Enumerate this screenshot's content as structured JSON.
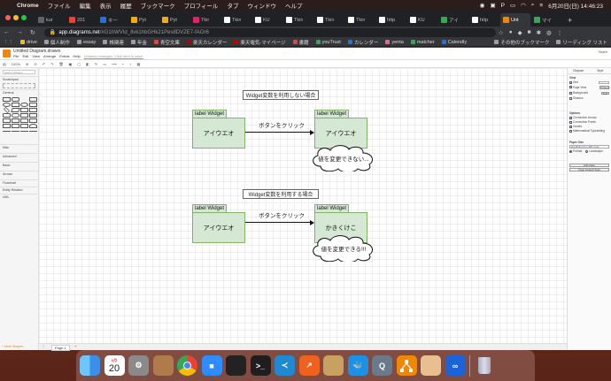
{
  "menubar": {
    "app": "Chrome",
    "items": [
      "ファイル",
      "編集",
      "表示",
      "履歴",
      "ブックマーク",
      "プロフィール",
      "タブ",
      "ウィンドウ",
      "ヘルプ"
    ],
    "datetime": "6月20日(日) 14:46:23"
  },
  "tabs": [
    {
      "label": "kur",
      "color": "#5f6368"
    },
    {
      "label": "201",
      "color": "#ea4335"
    },
    {
      "label": "キー",
      "color": "#1a73e8"
    },
    {
      "label": "Pyt",
      "color": "#f9ab00"
    },
    {
      "label": "Pyt",
      "color": "#f9ab00"
    },
    {
      "label": "Tkir",
      "color": "#e91e63"
    },
    {
      "label": "Tkin",
      "color": "#ffffff"
    },
    {
      "label": "KU",
      "color": "#ffffff"
    },
    {
      "label": "Tkin",
      "color": "#ffffff"
    },
    {
      "label": "Tkin",
      "color": "#ffffff"
    },
    {
      "label": "Tkin",
      "color": "#ffffff"
    },
    {
      "label": "http",
      "color": "#ffffff"
    },
    {
      "label": "KU",
      "color": "#ffffff"
    },
    {
      "label": "アイ",
      "color": "#34a853"
    },
    {
      "label": "http",
      "color": "#ffffff"
    },
    {
      "label": "Unt",
      "color": "#f08705",
      "active": true
    },
    {
      "label": "マイ",
      "color": "#34a853"
    }
  ],
  "address": {
    "domain": "app.diagrams.net",
    "rest": "/#G1hWVId_8vk1hbGHk21Pes8DVZE7-fAOr6"
  },
  "bookmarks": [
    "drive",
    "個人制作",
    "essay",
    "株関連",
    "年金",
    "青空文庫",
    "楽天カレンダー",
    "楽天電気-マイページ",
    "書籍",
    "youTrust",
    "カレンダー",
    "yenta",
    "matcher",
    "Calendly"
  ],
  "bookmarks_right": [
    "その他のブックマーク",
    "リーディング リスト"
  ],
  "drawio": {
    "filename": "Untitled Diagram.drawio",
    "menu": [
      "File",
      "Edit",
      "View",
      "Arrange",
      "Extras",
      "Help"
    ],
    "unsaved": "Unsaved changes. Click here to save.",
    "share": "Share",
    "zoom": "100%",
    "search_placeholder": "Search Shapes",
    "sections": [
      "Scratchpad",
      "General",
      "Misc",
      "Advanced",
      "Basic",
      "Arrows",
      "Flowchart",
      "Entity Relation",
      "UML"
    ],
    "more_shapes": "+ More Shapes...",
    "page_tab": "Page-1",
    "right_tabs": [
      "Diagram",
      "Style"
    ],
    "right": {
      "view": "View",
      "grid": "Grid",
      "page_view": "Page View",
      "background": "Background",
      "shadow": "Shadow",
      "options": "Options",
      "connection_arrows": "Connection Arrows",
      "connection_points": "Connection Points",
      "guides": "Guides",
      "math": "Mathematical Typesetting",
      "paper_size": "Paper Size",
      "paper_value": "A4 (210 mm x 297 mm)",
      "portrait": "Portrait",
      "landscape": "Landscape",
      "edit_data": "Edit Data",
      "clear_style": "Clear Default Style",
      "change": "Change",
      "edit": "Edit"
    }
  },
  "diagram": {
    "top_title": "Widget変数を利用しない場合",
    "bottom_title": "Widget変数を利用する場合",
    "widget_label": "label Widget",
    "top_left_text": "アイウエオ",
    "top_right_text": "アイウエオ",
    "top_arrow_label": "ボタンをクリック",
    "top_cloud_text": "値を変更できない...",
    "bottom_left_text": "アイウエオ",
    "bottom_right_text": "かきくけこ",
    "bottom_arrow_label": "ボタンをクリック",
    "bottom_cloud_text": "値を変更できる!!!"
  },
  "dock": [
    {
      "name": "finder-icon",
      "color": "#3d8ef0",
      "glyph": ""
    },
    {
      "name": "calendar-icon",
      "color": "#ffffff",
      "glyph": "20",
      "month": "6月"
    },
    {
      "name": "system-preferences-icon",
      "color": "#8a8a8a",
      "glyph": "⚙"
    },
    {
      "name": "contacts-icon",
      "color": "#b07a4a",
      "glyph": ""
    },
    {
      "name": "chrome-icon",
      "color": "#ffffff",
      "glyph": ""
    },
    {
      "name": "zoom-icon",
      "color": "#2d8cff",
      "glyph": "■"
    },
    {
      "name": "activity-monitor-icon",
      "color": "#222222",
      "glyph": ""
    },
    {
      "name": "terminal-icon",
      "color": "#1e1e1e",
      "glyph": ">_"
    },
    {
      "name": "vscode-icon",
      "color": "#1f8ad2",
      "glyph": "≺"
    },
    {
      "name": "keynote-icon",
      "color": "#f0601e",
      "glyph": "↗"
    },
    {
      "name": "archive-utility-icon",
      "color": "#c8a060",
      "glyph": ""
    },
    {
      "name": "docker-icon",
      "color": "#1d91e6",
      "glyph": "🐳"
    },
    {
      "name": "quicktime-icon",
      "color": "#6a7a8a",
      "glyph": "Q"
    },
    {
      "name": "drawio-icon",
      "color": "#f08705",
      "glyph": ""
    },
    {
      "name": "preview-icon",
      "color": "#e8c090",
      "glyph": ""
    },
    {
      "name": "infinity-icon",
      "color": "#1a63d8",
      "glyph": "∞"
    },
    {
      "name": "trash-icon",
      "color": "#9aa0a8",
      "glyph": ""
    }
  ]
}
